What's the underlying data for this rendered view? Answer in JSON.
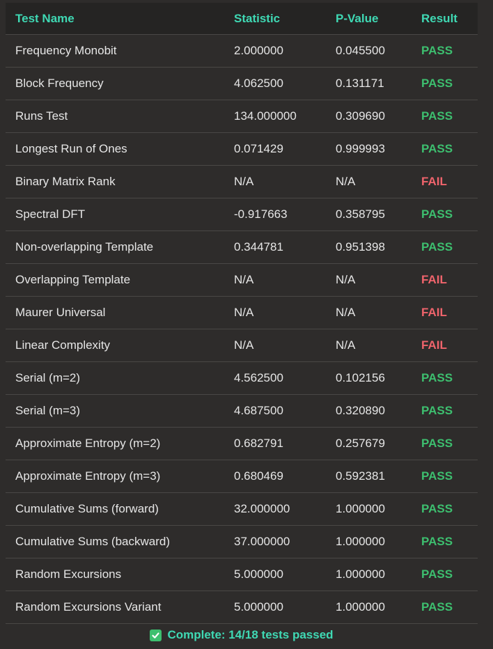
{
  "table": {
    "headers": {
      "test_name": "Test Name",
      "statistic": "Statistic",
      "p_value": "P-Value",
      "result": "Result"
    },
    "rows": [
      {
        "name": "Frequency Monobit",
        "statistic": "2.000000",
        "p_value": "0.045500",
        "result": "PASS"
      },
      {
        "name": "Block Frequency",
        "statistic": "4.062500",
        "p_value": "0.131171",
        "result": "PASS"
      },
      {
        "name": "Runs Test",
        "statistic": "134.000000",
        "p_value": "0.309690",
        "result": "PASS"
      },
      {
        "name": "Longest Run of Ones",
        "statistic": "0.071429",
        "p_value": "0.999993",
        "result": "PASS"
      },
      {
        "name": "Binary Matrix Rank",
        "statistic": "N/A",
        "p_value": "N/A",
        "result": "FAIL"
      },
      {
        "name": "Spectral DFT",
        "statistic": "-0.917663",
        "p_value": "0.358795",
        "result": "PASS"
      },
      {
        "name": "Non-overlapping Template",
        "statistic": "0.344781",
        "p_value": "0.951398",
        "result": "PASS"
      },
      {
        "name": "Overlapping Template",
        "statistic": "N/A",
        "p_value": "N/A",
        "result": "FAIL"
      },
      {
        "name": "Maurer Universal",
        "statistic": "N/A",
        "p_value": "N/A",
        "result": "FAIL"
      },
      {
        "name": "Linear Complexity",
        "statistic": "N/A",
        "p_value": "N/A",
        "result": "FAIL"
      },
      {
        "name": "Serial (m=2)",
        "statistic": "4.562500",
        "p_value": "0.102156",
        "result": "PASS"
      },
      {
        "name": "Serial (m=3)",
        "statistic": "4.687500",
        "p_value": "0.320890",
        "result": "PASS"
      },
      {
        "name": "Approximate Entropy (m=2)",
        "statistic": "0.682791",
        "p_value": "0.257679",
        "result": "PASS"
      },
      {
        "name": "Approximate Entropy (m=3)",
        "statistic": "0.680469",
        "p_value": "0.592381",
        "result": "PASS"
      },
      {
        "name": "Cumulative Sums (forward)",
        "statistic": "32.000000",
        "p_value": "1.000000",
        "result": "PASS"
      },
      {
        "name": "Cumulative Sums (backward)",
        "statistic": "37.000000",
        "p_value": "1.000000",
        "result": "PASS"
      },
      {
        "name": "Random Excursions",
        "statistic": "5.000000",
        "p_value": "1.000000",
        "result": "PASS"
      },
      {
        "name": "Random Excursions Variant",
        "statistic": "5.000000",
        "p_value": "1.000000",
        "result": "PASS"
      }
    ]
  },
  "footer": {
    "icon": "check-box-icon",
    "text": "Complete: 14/18 tests passed"
  },
  "colors": {
    "background": "#2e2c2b",
    "header_background": "#252423",
    "header_text": "#3fd9b4",
    "pass": "#3dbf6f",
    "fail": "#f0646c",
    "row_divider": "#4a4846"
  }
}
